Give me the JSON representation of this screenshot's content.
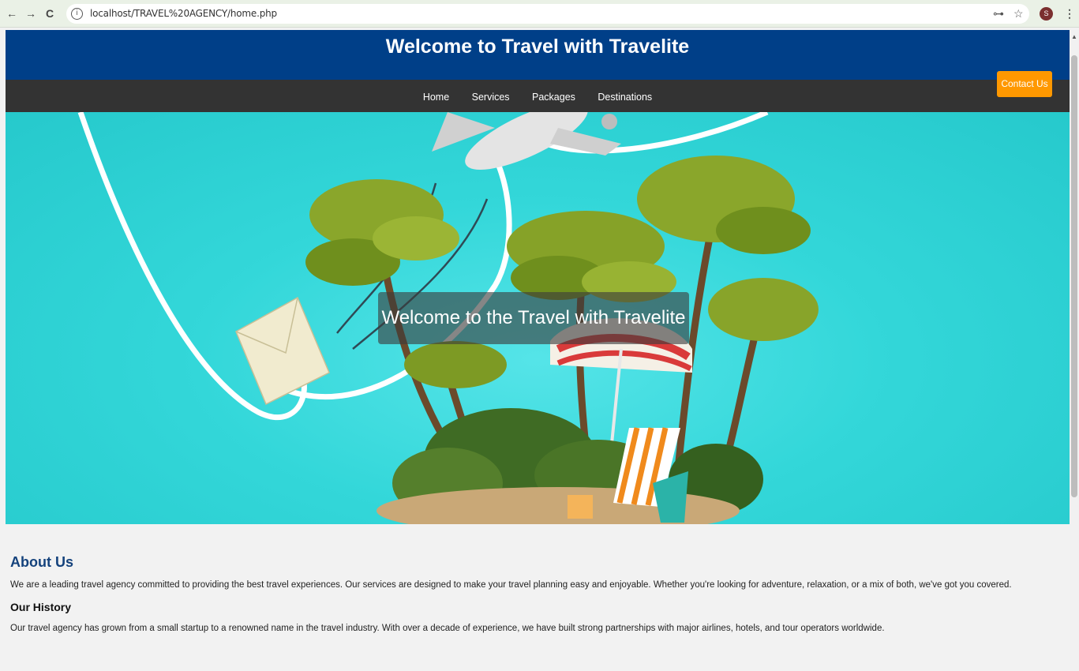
{
  "browser": {
    "url": "localhost/TRAVEL%20AGENCY/home.php",
    "back_icon": "←",
    "forward_icon": "→",
    "reload_icon": "C",
    "info_icon": "ⓘ",
    "key_icon": "⊶",
    "star_icon": "☆",
    "avatar_letter": "S",
    "menu_icon": "⋮"
  },
  "header": {
    "title": "Welcome to Travel with Travelite"
  },
  "nav": {
    "items": [
      {
        "label": "Home"
      },
      {
        "label": "Services"
      },
      {
        "label": "Packages"
      },
      {
        "label": "Destinations"
      }
    ]
  },
  "contact_button": {
    "label": "Contact Us"
  },
  "hero": {
    "caption": "Welcome to the Travel with Travelite"
  },
  "about": {
    "heading": "About Us",
    "text": "We are a leading travel agency committed to providing the best travel experiences. Our services are designed to make your travel planning easy and enjoyable. Whether you're looking for adventure, relaxation, or a mix of both, we've got you covered.",
    "history_heading": "Our History",
    "history_text": "Our travel agency has grown from a small startup to a renowned name in the travel industry. With over a decade of experience, we have built strong partnerships with major airlines, hotels, and tour operators worldwide."
  },
  "colors": {
    "header_bg": "#003f88",
    "nav_bg": "#333333",
    "hero_bg": "#33d7d9",
    "contact_bg": "#ff9800",
    "about_heading": "#14427c"
  }
}
